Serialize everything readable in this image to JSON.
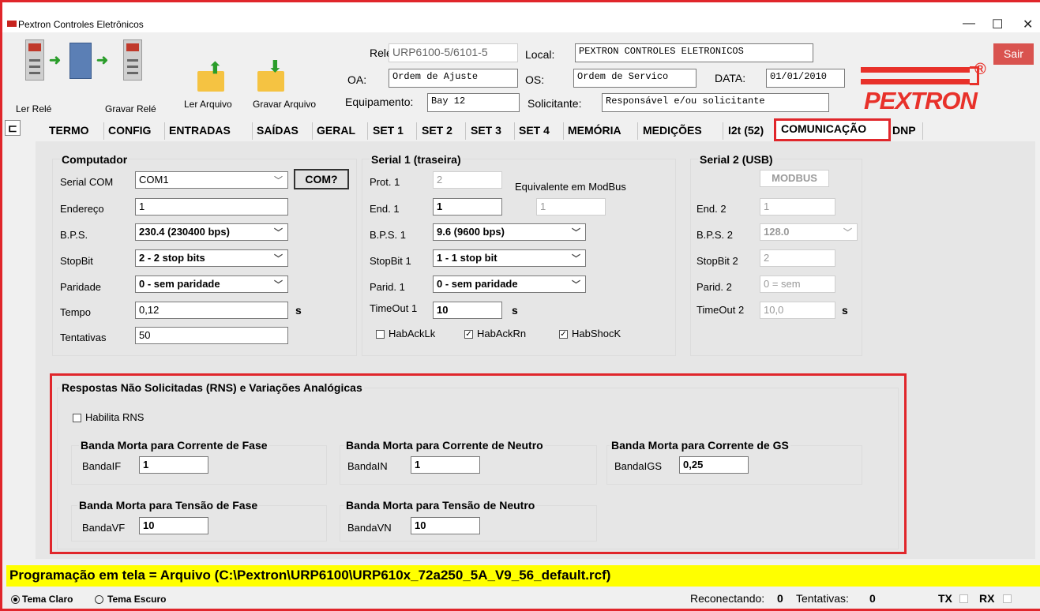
{
  "window": {
    "title": "Pextron Controles Eletrônicos",
    "minimize": "—",
    "maximize": "☐",
    "close": "✕"
  },
  "toolbar": {
    "read_relay": "Ler Relé",
    "write_relay": "Gravar Relé",
    "read_file": "Ler Arquivo",
    "write_file": "Gravar Arquivo",
    "exit": "Sair"
  },
  "header": {
    "rele_label": "Relé:",
    "rele_value": "URP6100-5/6101-5",
    "local_label": "Local:",
    "local_value": "PEXTRON CONTROLES ELETRONICOS",
    "oa_label": "OA:",
    "oa_value": "Ordem de Ajuste",
    "os_label": "OS:",
    "os_value": "Ordem de Servico",
    "data_label": "DATA:",
    "data_value": "01/01/2010",
    "equip_label": "Equipamento:",
    "equip_value": "Bay 12",
    "solic_label": "Solicitante:",
    "solic_value": "Responsável e/ou solicitante",
    "logo_text": "PEXTRON",
    "logo_reg": "®"
  },
  "tabs": [
    "TERMO",
    "CONFIG",
    "ENTRADAS",
    "SAÍDAS",
    "GERAL",
    "SET 1",
    "SET 2",
    "SET 3",
    "SET 4",
    "MEMÓRIA",
    "MEDIÇÕES",
    "I2t (52)",
    "COMUNICAÇÃO",
    "DNP"
  ],
  "computador": {
    "title": "Computador",
    "serial_label": "Serial COM",
    "serial_value": "COM1",
    "com_button": "COM?",
    "endereco_label": "Endereço",
    "endereco_value": "1",
    "bps_label": "B.P.S.",
    "bps_value": "230.4 (230400 bps)",
    "stopbit_label": "StopBit",
    "stopbit_value": "2 - 2 stop bits",
    "paridade_label": "Paridade",
    "paridade_value": "0 - sem paridade",
    "tempo_label": "Tempo",
    "tempo_value": "0,12",
    "tempo_unit": "s",
    "tentativas_label": "Tentativas",
    "tentativas_value": "50"
  },
  "serial1": {
    "title": "Serial 1 (traseira)",
    "prot_label": "Prot. 1",
    "prot_value": "2",
    "equiv_label": "Equivalente em ModBus",
    "equiv_value": "1",
    "end_label": "End. 1",
    "end_value": "1",
    "bps_label": "B.P.S. 1",
    "bps_value": "9.6 (9600 bps)",
    "stopbit_label": "StopBit 1",
    "stopbit_value": "1 - 1 stop bit",
    "parid_label": "Parid. 1",
    "parid_value": "0 - sem paridade",
    "timeout_label": "TimeOut 1",
    "timeout_value": "10",
    "timeout_unit": "s",
    "hab_acklk": "HabAckLk",
    "hab_ackrn": "HabAckRn",
    "hab_shock": "HabShocK"
  },
  "serial2": {
    "title": "Serial 2 (USB)",
    "modbus": "MODBUS",
    "end_label": "End. 2",
    "end_value": "1",
    "bps_label": "B.P.S. 2",
    "bps_value": "128.0",
    "stopbit_label": "StopBit 2",
    "stopbit_value": "2",
    "parid_label": "Parid. 2",
    "parid_value": "0 = sem",
    "timeout_label": "TimeOut 2",
    "timeout_value": "10,0",
    "timeout_unit": "s"
  },
  "rns": {
    "title": "Respostas Não Solicitadas (RNS) e Variações Analógicas",
    "habilita": "Habilita RNS",
    "if_title": "Banda Morta para Corrente de Fase",
    "if_label": "BandaIF",
    "if_value": "1",
    "in_title": "Banda Morta para Corrente de Neutro",
    "in_label": "BandaIN",
    "in_value": "1",
    "igs_title": "Banda Morta para Corrente de GS",
    "igs_label": "BandaIGS",
    "igs_value": "0,25",
    "vf_title": "Banda Morta para Tensão de Fase",
    "vf_label": "BandaVF",
    "vf_value": "10",
    "vn_title": "Banda Morta para Tensão de Neutro",
    "vn_label": "BandaVN",
    "vn_value": "10"
  },
  "status": {
    "text": "Programação em tela = Arquivo (C:\\Pextron\\URP6100\\URP610x_72a250_5A_V9_56_default.rcf)"
  },
  "footer": {
    "tema_claro": "Tema Claro",
    "tema_escuro": "Tema Escuro",
    "reconectando_label": "Reconectando:",
    "reconectando_value": "0",
    "tentativas_label": "Tentativas:",
    "tentativas_value": "0",
    "tx": "TX",
    "rx": "RX"
  },
  "colors": {
    "highlight": "#e0262b",
    "logo": "#e8312a",
    "status_bg": "#ffff00",
    "exit_bg": "#d9534f"
  }
}
